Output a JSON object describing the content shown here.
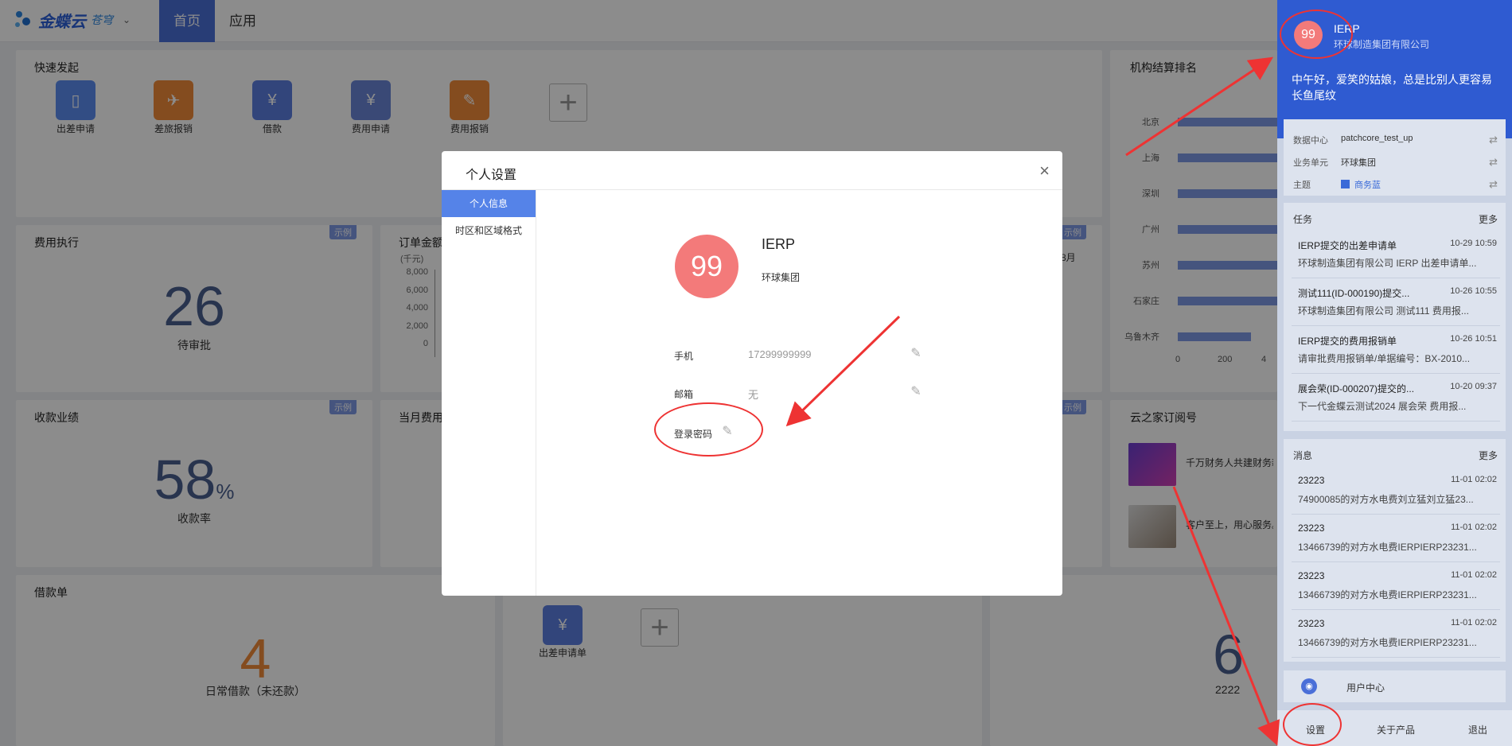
{
  "header": {
    "brand": "金蝶云",
    "brand_sub": "苍穹",
    "tabs": [
      "首页",
      "应用"
    ]
  },
  "quick_launch": {
    "title": "快速发起",
    "items": [
      {
        "label": "出差申请",
        "icon": "luggage-icon",
        "color": "#5b8df0"
      },
      {
        "label": "差旅报销",
        "icon": "flight-ticket-icon",
        "color": "#f08a3a"
      },
      {
        "label": "借款",
        "icon": "money-icon",
        "color": "#5b7fe0"
      },
      {
        "label": "费用申请",
        "icon": "expense-request-icon",
        "color": "#6b86d8"
      },
      {
        "label": "费用报销",
        "icon": "expense-reimburse-icon",
        "color": "#f08a3a"
      }
    ]
  },
  "ranking": {
    "title": "机构结算排名",
    "cities": [
      "北京",
      "上海",
      "深圳",
      "广州",
      "苏州",
      "石家庄",
      "乌鲁木齐"
    ],
    "ticks": [
      "0",
      "200",
      "4"
    ]
  },
  "expense_exec": {
    "title": "费用执行",
    "tag": "示例",
    "value": "26",
    "label": "待审批"
  },
  "order_amount": {
    "title": "订单金额",
    "unit": "(千元)",
    "ticks": [
      "8,000",
      "6,000",
      "4,000",
      "2,000",
      "0"
    ],
    "tag": "示例",
    "month": "8月"
  },
  "receipt": {
    "title": "收款业绩",
    "tag": "示例",
    "value": "58",
    "suffix": "%",
    "label": "收款率"
  },
  "month_expense": {
    "title": "当月费用",
    "tag": "示例"
  },
  "subscription": {
    "title": "云之家订阅号",
    "items": [
      {
        "text": "千万财务人共建财务新"
      },
      {
        "text": "客户至上，用心服务。"
      }
    ]
  },
  "loan": {
    "title": "借款单",
    "value": "4",
    "label": "日常借款（未还款）"
  },
  "bottom_mid": {
    "item_label": "出差申请单"
  },
  "bottom_right": {
    "value": "6",
    "label": "2222"
  },
  "modal": {
    "title": "个人设置",
    "close": "×",
    "side_items": [
      "个人信息",
      "时区和区域格式"
    ],
    "avatar": "99",
    "name": "IERP",
    "org": "环球集团",
    "phone_label": "手机",
    "phone_value": "17299999999",
    "email_label": "邮箱",
    "email_value": "无",
    "password_label": "登录密码"
  },
  "right_panel": {
    "avatar": "99",
    "name": "IERP",
    "org": "环球制造集团有限公司",
    "greeting": "中午好，爱笑的姑娘，总是比别人更容易长鱼尾纹",
    "info": [
      {
        "label": "数据中心",
        "value": "patchcore_test_up"
      },
      {
        "label": "业务单元",
        "value": "环球集团"
      },
      {
        "label": "主题",
        "value": "商务蓝"
      }
    ],
    "tasks_title": "任务",
    "tasks_more": "更多",
    "tasks": [
      {
        "title": "IERP提交的出差申请单",
        "date": "10-29 10:59",
        "sub": "环球制造集团有限公司 IERP 出差申请单..."
      },
      {
        "title": "测试111(ID-000190)提交...",
        "date": "10-26 10:55",
        "sub": "环球制造集团有限公司 测试111 费用报..."
      },
      {
        "title": "IERP提交的费用报销单",
        "date": "10-26 10:51",
        "sub": "请审批费用报销单/单据编号：BX-2010..."
      },
      {
        "title": "展会荣(ID-000207)提交的...",
        "date": "10-20 09:37",
        "sub": "下一代金蝶云测试2024 展会荣 费用报..."
      }
    ],
    "msgs_title": "消息",
    "msgs_more": "更多",
    "msgs": [
      {
        "title": "23223",
        "date": "11-01 02:02",
        "sub": "74900085的对方水电费刘立猛刘立猛23..."
      },
      {
        "title": "23223",
        "date": "11-01 02:02",
        "sub": "13466739的对方水电费IERPIERP23231..."
      },
      {
        "title": "23223",
        "date": "11-01 02:02",
        "sub": "13466739的对方水电费IERPIERP23231..."
      },
      {
        "title": "23223",
        "date": "11-01 02:02",
        "sub": "13466739的对方水电费IERPIERP23231..."
      }
    ],
    "user_center": "用户中心",
    "footer": [
      "设置",
      "关于产品",
      "退出"
    ]
  }
}
